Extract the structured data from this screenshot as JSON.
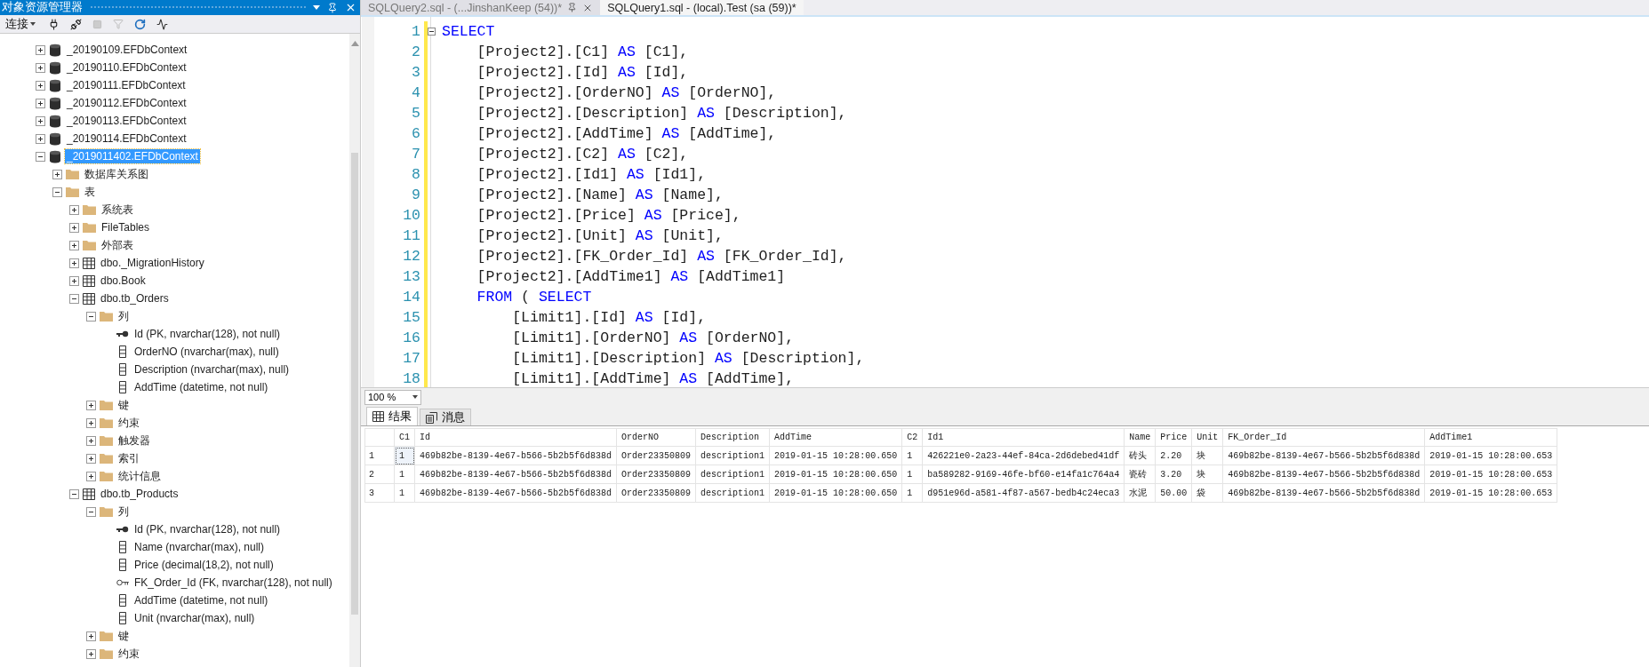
{
  "explorer": {
    "title": "对象资源管理器",
    "connect_label": "连接",
    "tree": [
      {
        "label": "_20190109.EFDbContext",
        "kind": "database",
        "expanded": false,
        "selected": false
      },
      {
        "label": "_20190110.EFDbContext",
        "kind": "database",
        "expanded": false,
        "selected": false
      },
      {
        "label": "_20190111.EFDbContext",
        "kind": "database",
        "expanded": false,
        "selected": false
      },
      {
        "label": "_20190112.EFDbContext",
        "kind": "database",
        "expanded": false,
        "selected": false
      },
      {
        "label": "_20190113.EFDbContext",
        "kind": "database",
        "expanded": false,
        "selected": false
      },
      {
        "label": "_20190114.EFDbContext",
        "kind": "database",
        "expanded": false,
        "selected": false
      },
      {
        "label": "_2019011402.EFDbContext",
        "kind": "database",
        "expanded": true,
        "selected": true,
        "children": [
          {
            "label": "数据库关系图",
            "kind": "folder",
            "expanded": false,
            "selected": false
          },
          {
            "label": "表",
            "kind": "folder",
            "expanded": true,
            "selected": false,
            "children": [
              {
                "label": "系统表",
                "kind": "folder",
                "expanded": false,
                "selected": false
              },
              {
                "label": "FileTables",
                "kind": "folder",
                "expanded": false,
                "selected": false
              },
              {
                "label": "外部表",
                "kind": "folder",
                "expanded": false,
                "selected": false
              },
              {
                "label": "dbo._MigrationHistory",
                "kind": "table",
                "expanded": false,
                "selected": false
              },
              {
                "label": "dbo.Book",
                "kind": "table",
                "expanded": false,
                "selected": false
              },
              {
                "label": "dbo.tb_Orders",
                "kind": "table",
                "expanded": true,
                "selected": false,
                "children": [
                  {
                    "label": "列",
                    "kind": "folder",
                    "expanded": true,
                    "selected": false,
                    "children": [
                      {
                        "label": "Id (PK, nvarchar(128), not null)",
                        "kind": "key",
                        "selected": false
                      },
                      {
                        "label": "OrderNO (nvarchar(max), null)",
                        "kind": "column",
                        "selected": false
                      },
                      {
                        "label": "Description (nvarchar(max), null)",
                        "kind": "column",
                        "selected": false
                      },
                      {
                        "label": "AddTime (datetime, not null)",
                        "kind": "column",
                        "selected": false
                      }
                    ]
                  },
                  {
                    "label": "键",
                    "kind": "folder",
                    "expanded": false,
                    "selected": false
                  },
                  {
                    "label": "约束",
                    "kind": "folder",
                    "expanded": false,
                    "selected": false
                  },
                  {
                    "label": "触发器",
                    "kind": "folder",
                    "expanded": false,
                    "selected": false
                  },
                  {
                    "label": "索引",
                    "kind": "folder",
                    "expanded": false,
                    "selected": false
                  },
                  {
                    "label": "统计信息",
                    "kind": "folder",
                    "expanded": false,
                    "selected": false
                  }
                ]
              },
              {
                "label": "dbo.tb_Products",
                "kind": "table",
                "expanded": true,
                "selected": false,
                "children": [
                  {
                    "label": "列",
                    "kind": "folder",
                    "expanded": true,
                    "selected": false,
                    "children": [
                      {
                        "label": "Id (PK, nvarchar(128), not null)",
                        "kind": "key",
                        "selected": false
                      },
                      {
                        "label": "Name (nvarchar(max), null)",
                        "kind": "column",
                        "selected": false
                      },
                      {
                        "label": "Price (decimal(18,2), not null)",
                        "kind": "column",
                        "selected": false
                      },
                      {
                        "label": "FK_Order_Id (FK, nvarchar(128), not null)",
                        "kind": "foreign-key",
                        "selected": false
                      },
                      {
                        "label": "AddTime (datetime, not null)",
                        "kind": "column",
                        "selected": false
                      },
                      {
                        "label": "Unit (nvarchar(max), null)",
                        "kind": "column",
                        "selected": false
                      }
                    ]
                  },
                  {
                    "label": "键",
                    "kind": "folder",
                    "expanded": false,
                    "selected": false
                  },
                  {
                    "label": "约束",
                    "kind": "folder",
                    "expanded": false,
                    "selected": false
                  }
                ]
              }
            ]
          }
        ]
      }
    ]
  },
  "editor_tabs": [
    {
      "label": "SQLQuery2.sql - (...JinshanKeep (54))*",
      "selected": true
    },
    {
      "label": "SQLQuery1.sql - (local).Test (sa (59))*",
      "selected": false
    }
  ],
  "editor": {
    "lines": [
      {
        "number": "1",
        "fold": true,
        "parts": [
          {
            "kind": "keyword",
            "text": "SELECT"
          }
        ]
      },
      {
        "number": "2",
        "fold": false,
        "parts": [
          {
            "kind": "text",
            "text": "    [Project2].[C1]"
          },
          {
            "kind": "keyword",
            "text": " AS "
          },
          {
            "kind": "text",
            "text": "[C1],"
          }
        ]
      },
      {
        "number": "3",
        "fold": false,
        "parts": [
          {
            "kind": "text",
            "text": "    [Project2].[Id]"
          },
          {
            "kind": "keyword",
            "text": " AS "
          },
          {
            "kind": "text",
            "text": "[Id],"
          }
        ]
      },
      {
        "number": "4",
        "fold": false,
        "parts": [
          {
            "kind": "text",
            "text": "    [Project2].[OrderNO]"
          },
          {
            "kind": "keyword",
            "text": " AS "
          },
          {
            "kind": "text",
            "text": "[OrderNO],"
          }
        ]
      },
      {
        "number": "5",
        "fold": false,
        "parts": [
          {
            "kind": "text",
            "text": "    [Project2].[Description]"
          },
          {
            "kind": "keyword",
            "text": " AS "
          },
          {
            "kind": "text",
            "text": "[Description],"
          }
        ]
      },
      {
        "number": "6",
        "fold": false,
        "parts": [
          {
            "kind": "text",
            "text": "    [Project2].[AddTime]"
          },
          {
            "kind": "keyword",
            "text": " AS "
          },
          {
            "kind": "text",
            "text": "[AddTime],"
          }
        ]
      },
      {
        "number": "7",
        "fold": false,
        "parts": [
          {
            "kind": "text",
            "text": "    [Project2].[C2]"
          },
          {
            "kind": "keyword",
            "text": " AS "
          },
          {
            "kind": "text",
            "text": "[C2],"
          }
        ]
      },
      {
        "number": "8",
        "fold": false,
        "parts": [
          {
            "kind": "text",
            "text": "    [Project2].[Id1]"
          },
          {
            "kind": "keyword",
            "text": " AS "
          },
          {
            "kind": "text",
            "text": "[Id1],"
          }
        ]
      },
      {
        "number": "9",
        "fold": false,
        "parts": [
          {
            "kind": "text",
            "text": "    [Project2].[Name]"
          },
          {
            "kind": "keyword",
            "text": " AS "
          },
          {
            "kind": "text",
            "text": "[Name],"
          }
        ]
      },
      {
        "number": "10",
        "fold": false,
        "parts": [
          {
            "kind": "text",
            "text": "    [Project2].[Price]"
          },
          {
            "kind": "keyword",
            "text": " AS "
          },
          {
            "kind": "text",
            "text": "[Price],"
          }
        ]
      },
      {
        "number": "11",
        "fold": false,
        "parts": [
          {
            "kind": "text",
            "text": "    [Project2].[Unit]"
          },
          {
            "kind": "keyword",
            "text": " AS "
          },
          {
            "kind": "text",
            "text": "[Unit],"
          }
        ]
      },
      {
        "number": "12",
        "fold": false,
        "parts": [
          {
            "kind": "text",
            "text": "    [Project2].[FK_Order_Id]"
          },
          {
            "kind": "keyword",
            "text": " AS "
          },
          {
            "kind": "text",
            "text": "[FK_Order_Id],"
          }
        ]
      },
      {
        "number": "13",
        "fold": false,
        "parts": [
          {
            "kind": "text",
            "text": "    [Project2].[AddTime1]"
          },
          {
            "kind": "keyword",
            "text": " AS "
          },
          {
            "kind": "text",
            "text": "[AddTime1]"
          }
        ]
      },
      {
        "number": "14",
        "fold": false,
        "parts": [
          {
            "kind": "keyword",
            "text": "    FROM"
          },
          {
            "kind": "text",
            "text": " ( "
          },
          {
            "kind": "keyword",
            "text": "SELECT"
          }
        ]
      },
      {
        "number": "15",
        "fold": false,
        "parts": [
          {
            "kind": "text",
            "text": "        [Limit1].[Id]"
          },
          {
            "kind": "keyword",
            "text": " AS "
          },
          {
            "kind": "text",
            "text": "[Id],"
          }
        ]
      },
      {
        "number": "16",
        "fold": false,
        "parts": [
          {
            "kind": "text",
            "text": "        [Limit1].[OrderNO]"
          },
          {
            "kind": "keyword",
            "text": " AS "
          },
          {
            "kind": "text",
            "text": "[OrderNO],"
          }
        ]
      },
      {
        "number": "17",
        "fold": false,
        "parts": [
          {
            "kind": "text",
            "text": "        [Limit1].[Description]"
          },
          {
            "kind": "keyword",
            "text": " AS "
          },
          {
            "kind": "text",
            "text": "[Description],"
          }
        ]
      },
      {
        "number": "18",
        "fold": false,
        "parts": [
          {
            "kind": "text",
            "text": "        [Limit1].[AddTime]"
          },
          {
            "kind": "keyword",
            "text": " AS "
          },
          {
            "kind": "text",
            "text": "[AddTime],"
          }
        ]
      }
    ]
  },
  "zoom": {
    "value": "100 %"
  },
  "result_tabs": [
    {
      "label": "结果",
      "kind": "grid",
      "selected": true
    },
    {
      "label": "消息",
      "kind": "messages",
      "selected": false
    }
  ],
  "results": {
    "columns": [
      "C1",
      "Id",
      "OrderNO",
      "Description",
      "AddTime",
      "C2",
      "Id1",
      "Name",
      "Price",
      "Unit",
      "FK_Order_Id",
      "AddTime1"
    ],
    "rows": [
      {
        "number": "1",
        "focused": true,
        "cells": [
          "1",
          "469b82be-8139-4e67-b566-5b2b5f6d838d",
          "Order23350809",
          "description1",
          "2019-01-15 10:28:00.650",
          "1",
          "426221e0-2a23-44ef-84ca-2d6debed41df",
          "砖头",
          "2.20",
          "块",
          "469b82be-8139-4e67-b566-5b2b5f6d838d",
          "2019-01-15 10:28:00.653"
        ]
      },
      {
        "number": "2",
        "focused": false,
        "cells": [
          "1",
          "469b82be-8139-4e67-b566-5b2b5f6d838d",
          "Order23350809",
          "description1",
          "2019-01-15 10:28:00.650",
          "1",
          "ba589282-9169-46fe-bf60-e14fa1c764a4",
          "瓷砖",
          "3.20",
          "块",
          "469b82be-8139-4e67-b566-5b2b5f6d838d",
          "2019-01-15 10:28:00.653"
        ]
      },
      {
        "number": "3",
        "focused": false,
        "cells": [
          "1",
          "469b82be-8139-4e67-b566-5b2b5f6d838d",
          "Order23350809",
          "description1",
          "2019-01-15 10:28:00.650",
          "1",
          "d951e96d-a581-4f87-a567-bedb4c24eca3",
          "水泥",
          "50.00",
          "袋",
          "469b82be-8139-4e67-b566-5b2b5f6d838d",
          "2019-01-15 10:28:00.653"
        ]
      }
    ]
  }
}
